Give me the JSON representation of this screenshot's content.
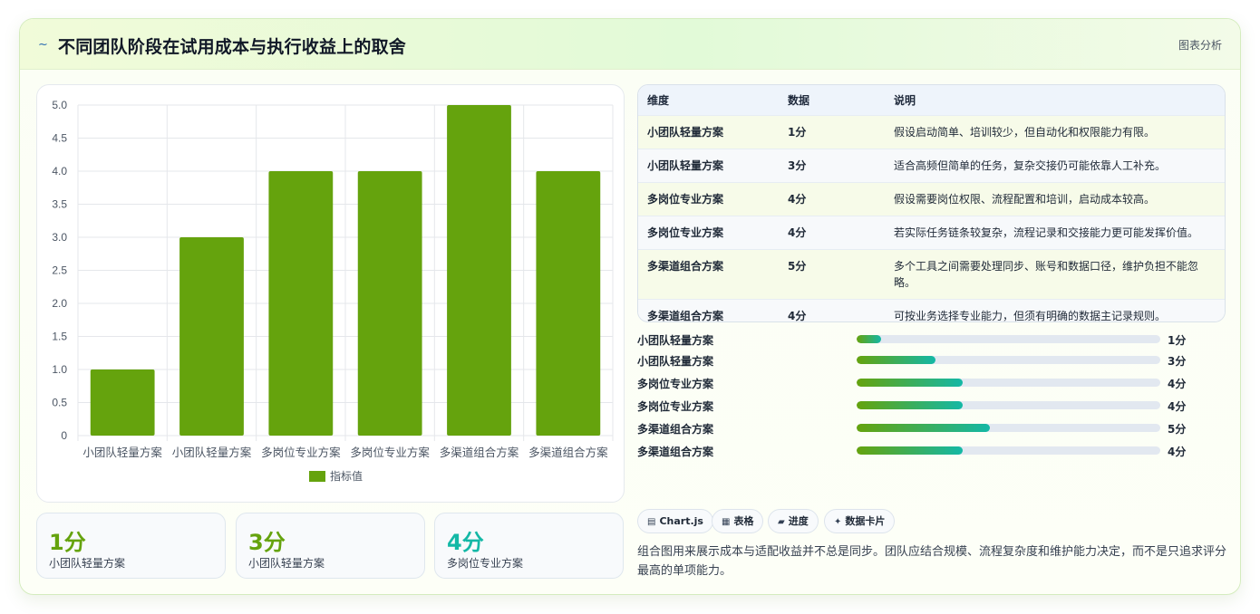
{
  "header": {
    "title_icon": "~",
    "title": "不同团队阶段在试用成本与执行收益上的取舍",
    "right_label": "图表分析"
  },
  "chart_data": {
    "type": "bar",
    "categories": [
      "小团队轻量方案",
      "小团队轻量方案",
      "多岗位专业方案",
      "多岗位专业方案",
      "多渠道组合方案",
      "多渠道组合方案"
    ],
    "series": [
      {
        "name": "指标值",
        "values": [
          1,
          3,
          4,
          4,
          5,
          4
        ],
        "color": "#65a30d"
      }
    ],
    "yticks": [
      "0",
      "0.5",
      "1.0",
      "1.5",
      "2.0",
      "2.5",
      "3.0",
      "3.5",
      "4.0",
      "4.5",
      "5.0"
    ],
    "ylim": [
      0,
      5
    ],
    "grid": true,
    "legend": "bottom"
  },
  "stats": [
    {
      "value": "1分",
      "label": "小团队轻量方案",
      "color": "#65a30d"
    },
    {
      "value": "3分",
      "label": "小团队轻量方案",
      "color": "#65a30d"
    },
    {
      "value": "4分",
      "label": "多岗位专业方案",
      "color": "#14b8a6"
    }
  ],
  "table": {
    "headers": [
      "维度",
      "数据",
      "说明"
    ],
    "rows": [
      {
        "dim": "小团队轻量方案",
        "data": "1分",
        "note": "假设启动简单、培训较少，但自动化和权限能力有限。"
      },
      {
        "dim": "小团队轻量方案",
        "data": "3分",
        "note": "适合高频但简单的任务，复杂交接仍可能依靠人工补充。"
      },
      {
        "dim": "多岗位专业方案",
        "data": "4分",
        "note": "假设需要岗位权限、流程配置和培训，启动成本较高。"
      },
      {
        "dim": "多岗位专业方案",
        "data": "4分",
        "note": "若实际任务链条较复杂，流程记录和交接能力更可能发挥价值。"
      },
      {
        "dim": "多渠道组合方案",
        "data": "5分",
        "note": "多个工具之间需要处理同步、账号和数据口径，维护负担不能忽略。"
      },
      {
        "dim": "多渠道组合方案",
        "data": "4分",
        "note": "可按业务选择专业能力，但须有明确的数据主记录规则。"
      }
    ]
  },
  "progress": [
    {
      "label": "小团队轻量方案",
      "value_text": "1分",
      "fraction": 0.08
    },
    {
      "label": "小团队轻量方案",
      "value_text": "3分",
      "fraction": 0.26
    },
    {
      "label": "多岗位专业方案",
      "value_text": "4分",
      "fraction": 0.35
    },
    {
      "label": "多岗位专业方案",
      "value_text": "4分",
      "fraction": 0.35
    },
    {
      "label": "多渠道组合方案",
      "value_text": "5分",
      "fraction": 0.44
    },
    {
      "label": "多渠道组合方案",
      "value_text": "4分",
      "fraction": 0.35
    }
  ],
  "tags": [
    {
      "icon": "▤",
      "label": "Chart.js"
    },
    {
      "icon": "▦",
      "label": "表格"
    },
    {
      "icon": "▰",
      "label": "进度"
    },
    {
      "icon": "✦",
      "label": "数据卡片"
    }
  ],
  "description": "组合图用来展示成本与适配收益并不总是同步。团队应结合规模、流程复杂度和维护能力决定，而不是只追求评分最高的单项能力。"
}
